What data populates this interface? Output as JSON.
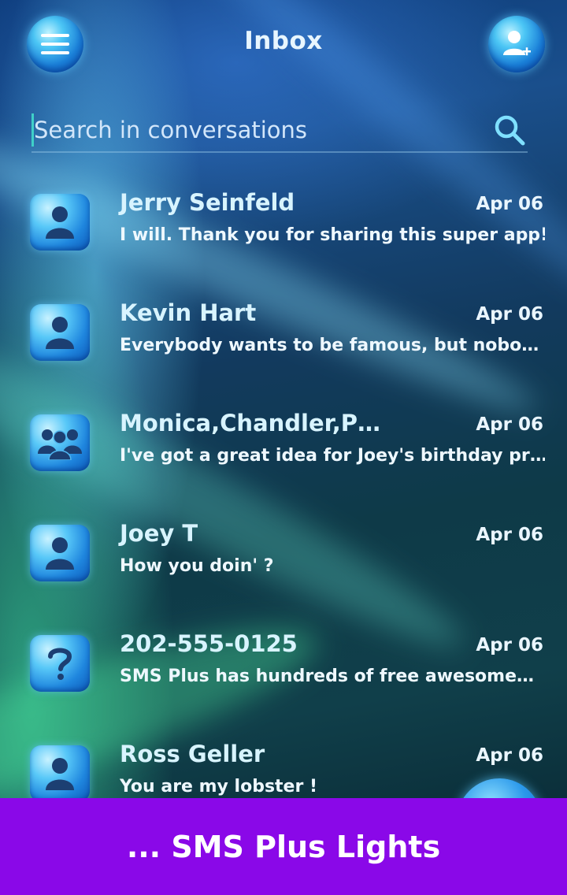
{
  "header": {
    "title": "Inbox",
    "menu_icon": "hamburger-menu-icon",
    "add_contact_icon": "add-contact-icon"
  },
  "search": {
    "placeholder": "Search in conversations",
    "icon": "search-icon"
  },
  "conversations": [
    {
      "name": "Jerry Seinfeld",
      "date": "Apr 06",
      "preview": "I will. Thank you for sharing this super app!",
      "avatar_icon": "person-icon"
    },
    {
      "name": "Kevin Hart",
      "date": "Apr 06",
      "preview": "Everybody wants to be famous, but nobo…",
      "avatar_icon": "person-icon"
    },
    {
      "name": "Monica,Chandler,P…",
      "date": "Apr 06",
      "preview": "I've got a great idea for Joey's birthday pr…",
      "avatar_icon": "group-icon"
    },
    {
      "name": "Joey T",
      "date": "Apr 06",
      "preview": "How you doin' ?",
      "avatar_icon": "person-icon"
    },
    {
      "name": "202-555-0125",
      "date": "Apr 06",
      "preview": "SMS Plus has hundreds of free awesome…",
      "avatar_icon": "unknown-contact-icon"
    },
    {
      "name": "Ross Geller",
      "date": "Apr 06",
      "preview": "You are my lobster !",
      "avatar_icon": "person-icon"
    }
  ],
  "banner": {
    "text": "... SMS Plus Lights"
  },
  "colors": {
    "accent": "#2a98ea",
    "banner": "#8a08e8",
    "text": "#d8f4ff"
  }
}
